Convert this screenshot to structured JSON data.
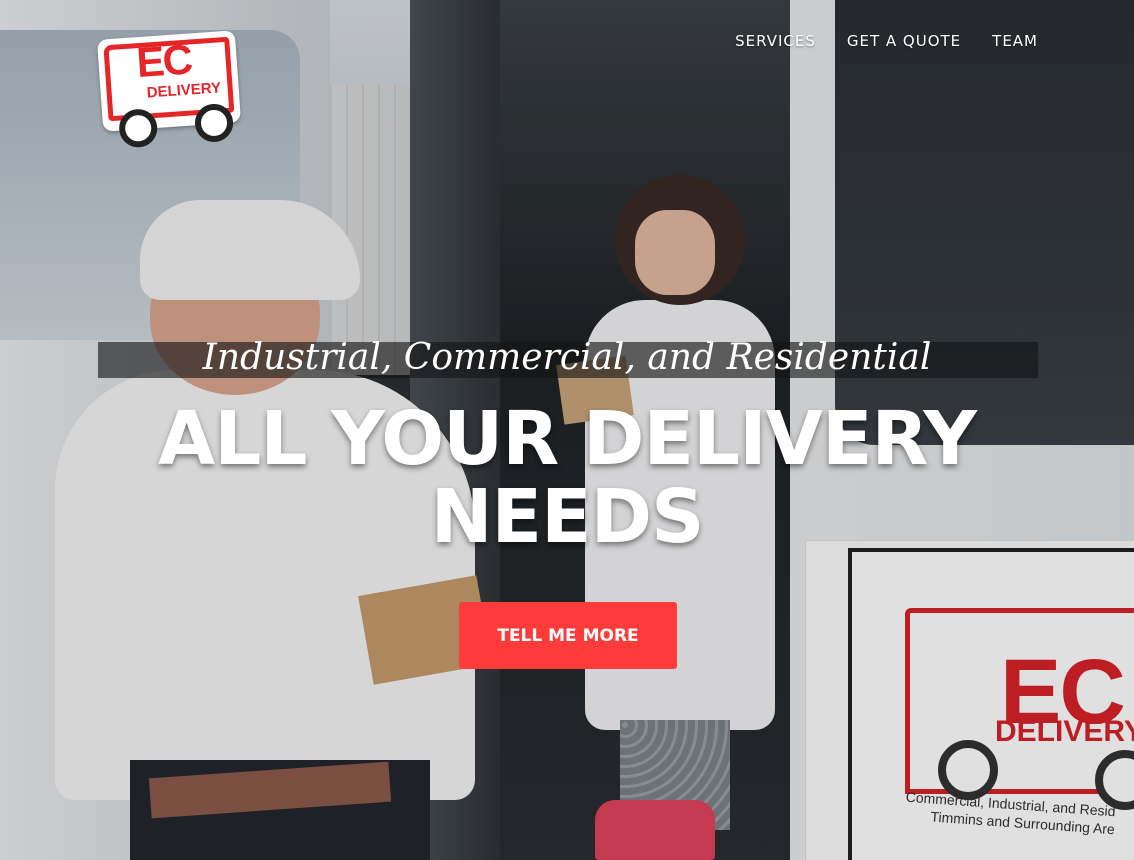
{
  "brand": {
    "logo_text": "EC",
    "logo_subtext": "DELIVERY"
  },
  "nav": {
    "items": [
      {
        "label": "SERVICES"
      },
      {
        "label": "GET A QUOTE"
      },
      {
        "label": "TEAM"
      }
    ]
  },
  "hero": {
    "subheading": "Industrial, Commercial, and Residential",
    "heading": "ALL YOUR DELIVERY NEEDS",
    "cta_label": "TELL ME MORE"
  },
  "van_sticker": {
    "brand": "EC",
    "brand_sub": "DELIVERY",
    "line1": "Commercial, Industrial, and Resid",
    "line2": "Timmins and Surrounding Are"
  },
  "colors": {
    "accent": "#fe3b3b",
    "logo_red": "#e52629"
  }
}
